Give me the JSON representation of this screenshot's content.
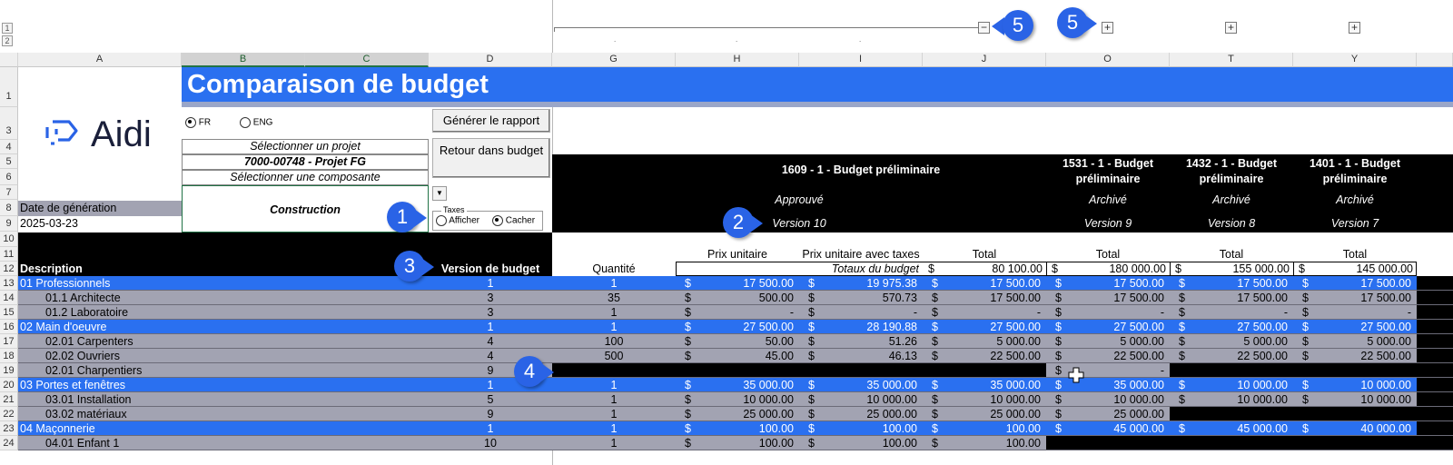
{
  "outline": {
    "levels": [
      "1",
      "2"
    ],
    "collapse_symbol": "−",
    "expand_symbol": "+"
  },
  "columns": [
    "A",
    "B",
    "C",
    "D",
    "G",
    "H",
    "I",
    "J",
    "O",
    "T",
    "Y"
  ],
  "rows": [
    "1",
    "3",
    "4",
    "5",
    "6",
    "7",
    "8",
    "9",
    "10",
    "11",
    "12",
    "13",
    "14",
    "15",
    "16",
    "17",
    "18",
    "19",
    "20",
    "21",
    "22",
    "23",
    "24"
  ],
  "title": "Comparaison de budget",
  "logo_text": "Aidi",
  "language": {
    "fr": "FR",
    "eng": "ENG",
    "selected": "FR"
  },
  "buttons": {
    "generate": "Générer le rapport",
    "back": "Retour dans budget"
  },
  "project": {
    "select_label": "Sélectionner un projet",
    "value": "7000-00748 - Projet FG",
    "component_label": "Sélectionner une composante",
    "component_value": "Construction"
  },
  "generation": {
    "label": "Date de génération",
    "date": "2025-03-23"
  },
  "taxes": {
    "legend": "Taxes",
    "show": "Afficher",
    "hide": "Cacher",
    "selected": "Cacher"
  },
  "budgets": {
    "main": {
      "name": "1609 - 1 - Budget préliminaire",
      "status": "Approuvé",
      "version": "Version 10"
    },
    "others": [
      {
        "name": "1531 - 1 - Budget préliminaire",
        "status": "Archivé",
        "version": "Version 9"
      },
      {
        "name": "1432 - 1 - Budget préliminaire",
        "status": "Archivé",
        "version": "Version 8"
      },
      {
        "name": "1401 - 1 - Budget préliminaire",
        "status": "Archivé",
        "version": "Version 7"
      }
    ]
  },
  "headers": {
    "description": "Description",
    "version": "Version de budget",
    "quantity": "Quantité",
    "unit_price": "Prix unitaire",
    "unit_price_tax": "Prix unitaire avec taxes",
    "total": "Total",
    "totals_label": "Totaux du budget",
    "currency": "$"
  },
  "totals": [
    "80 100.00",
    "180 000.00",
    "155 000.00",
    "145 000.00"
  ],
  "lines": [
    {
      "row": "13",
      "desc": "01 Professionnels",
      "ver": "1",
      "qty": "1",
      "up": "17 500.00",
      "upt": "19 975.38",
      "tot": "17 500.00",
      "o": "17 500.00",
      "t": "17 500.00",
      "y": "17 500.00"
    },
    {
      "row": "14",
      "desc": "01.1 Architecte",
      "ver": "3",
      "qty": "35",
      "up": "500.00",
      "upt": "570.73",
      "tot": "17 500.00",
      "o": "17 500.00",
      "t": "17 500.00",
      "y": "17 500.00"
    },
    {
      "row": "15",
      "desc": "01.2 Laboratoire",
      "ver": "3",
      "qty": "1",
      "up": "-",
      "upt": "-",
      "tot": "-",
      "o": "-",
      "t": "-",
      "y": "-"
    },
    {
      "row": "16",
      "desc": "02 Main d'oeuvre",
      "ver": "1",
      "qty": "1",
      "up": "27 500.00",
      "upt": "28 190.88",
      "tot": "27 500.00",
      "o": "27 500.00",
      "t": "27 500.00",
      "y": "27 500.00"
    },
    {
      "row": "17",
      "desc": "02.01 Carpenters",
      "ver": "4",
      "qty": "100",
      "up": "50.00",
      "upt": "51.26",
      "tot": "5 000.00",
      "o": "5 000.00",
      "t": "5 000.00",
      "y": "5 000.00"
    },
    {
      "row": "18",
      "desc": "02.02 Ouvriers",
      "ver": "4",
      "qty": "500",
      "up": "45.00",
      "upt": "46.13",
      "tot": "22 500.00",
      "o": "22 500.00",
      "t": "22 500.00",
      "y": "22 500.00"
    },
    {
      "row": "19",
      "desc": "02.01 Charpentiers",
      "ver": "9",
      "o": "-"
    },
    {
      "row": "20",
      "desc": "03 Portes et fenêtres",
      "ver": "1",
      "qty": "1",
      "up": "35 000.00",
      "upt": "35 000.00",
      "tot": "35 000.00",
      "o": "35 000.00",
      "t": "10 000.00",
      "y": "10 000.00"
    },
    {
      "row": "21",
      "desc": "03.01 Installation",
      "ver": "5",
      "qty": "1",
      "up": "10 000.00",
      "upt": "10 000.00",
      "tot": "10 000.00",
      "o": "10 000.00",
      "t": "10 000.00",
      "y": "10 000.00"
    },
    {
      "row": "22",
      "desc": "03.02 matériaux",
      "ver": "9",
      "qty": "1",
      "up": "25 000.00",
      "upt": "25 000.00",
      "tot": "25 000.00",
      "o": "25 000.00"
    },
    {
      "row": "23",
      "desc": "04 Maçonnerie",
      "ver": "1",
      "qty": "1",
      "up": "100.00",
      "upt": "100.00",
      "tot": "100.00",
      "o": "45 000.00",
      "t": "45 000.00",
      "y": "40 000.00"
    },
    {
      "row": "24",
      "desc": "04.01 Enfant 1",
      "ver": "10",
      "qty": "1",
      "up": "100.00",
      "upt": "100.00",
      "tot": "100.00"
    }
  ],
  "callouts": [
    "1",
    "2",
    "3",
    "4",
    "5",
    "5"
  ],
  "colors": {
    "accent": "#2a70f0",
    "header_bg": "#000000",
    "subrow_bg": "#a2a3b2",
    "callout": "#2a63e6"
  }
}
